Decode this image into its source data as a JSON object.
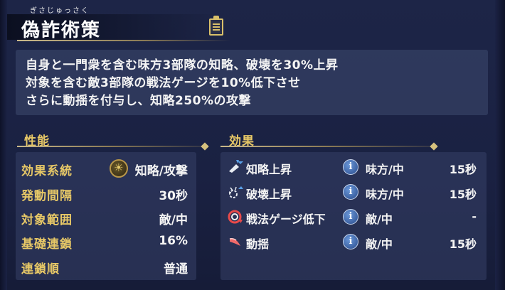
{
  "header": {
    "ruby": "ぎさじゅっさく",
    "title": "偽詐術策"
  },
  "description": [
    "自身と一門衆を含む味方3部隊の知略、破壊を30%上昇",
    "対象を含む敵3部隊の戦法ゲージを10%低下させ",
    "さらに動揺を付与し、知略250%の攻撃"
  ],
  "performance": {
    "heading": "性能",
    "rows": [
      {
        "label": "効果系統",
        "value": "知略/攻撃",
        "icon": "strategy-attack-icon"
      },
      {
        "label": "発動間隔",
        "value": "30秒"
      },
      {
        "label": "対象範囲",
        "value": "敵/中"
      },
      {
        "label": "基礎連鎖",
        "value": "16%"
      },
      {
        "label": "連鎖順",
        "value": "普通"
      }
    ]
  },
  "effects": {
    "heading": "効果",
    "rows": [
      {
        "name": "知略上昇",
        "icon": "intellect-up-icon",
        "target": "味方/中",
        "duration": "15秒"
      },
      {
        "name": "破壊上昇",
        "icon": "destruction-up-icon",
        "target": "味方/中",
        "duration": "15秒"
      },
      {
        "name": "戦法ゲージ低下",
        "icon": "gauge-down-icon",
        "target": "敵/中",
        "duration": "-"
      },
      {
        "name": "動揺",
        "icon": "agitation-icon",
        "target": "敵/中",
        "duration": "15秒"
      }
    ]
  },
  "colors": {
    "accent_gold": "#e7c867",
    "background": "#1d2547",
    "panel": "#343e64",
    "info_blue": "#4a76b8"
  }
}
